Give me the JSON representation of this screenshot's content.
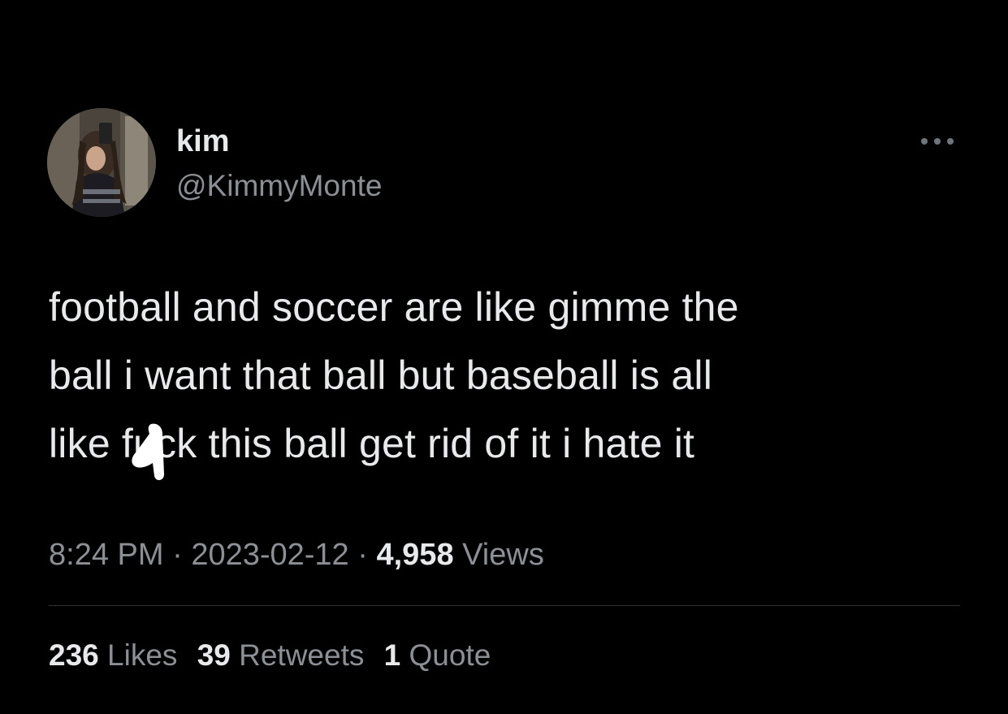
{
  "author": {
    "name": "kim",
    "handle": "@KimmyMonte",
    "avatar_icon": "profile-photo"
  },
  "menu_icon": "more-options-icon",
  "tweet": {
    "line1": "football and soccer are like gimme the",
    "line2": "ball i want that ball but baseball is all",
    "line3_prefix": "like f",
    "line3_censored": "u",
    "line3_suffix": "ck this ball get rid of it i hate it"
  },
  "meta": {
    "time": "8:24 PM",
    "separator": "·",
    "date": "2023-02-12",
    "views_count": "4,958",
    "views_label": "Views"
  },
  "stats": {
    "likes_count": "236",
    "likes_label": "Likes",
    "retweets_count": "39",
    "retweets_label": "Retweets",
    "quotes_count": "1",
    "quotes_label": "Quote"
  },
  "colors": {
    "background": "#000000",
    "primary_text": "#e7e9ea",
    "secondary_text": "#8b9096",
    "divider": "#2f3336"
  }
}
